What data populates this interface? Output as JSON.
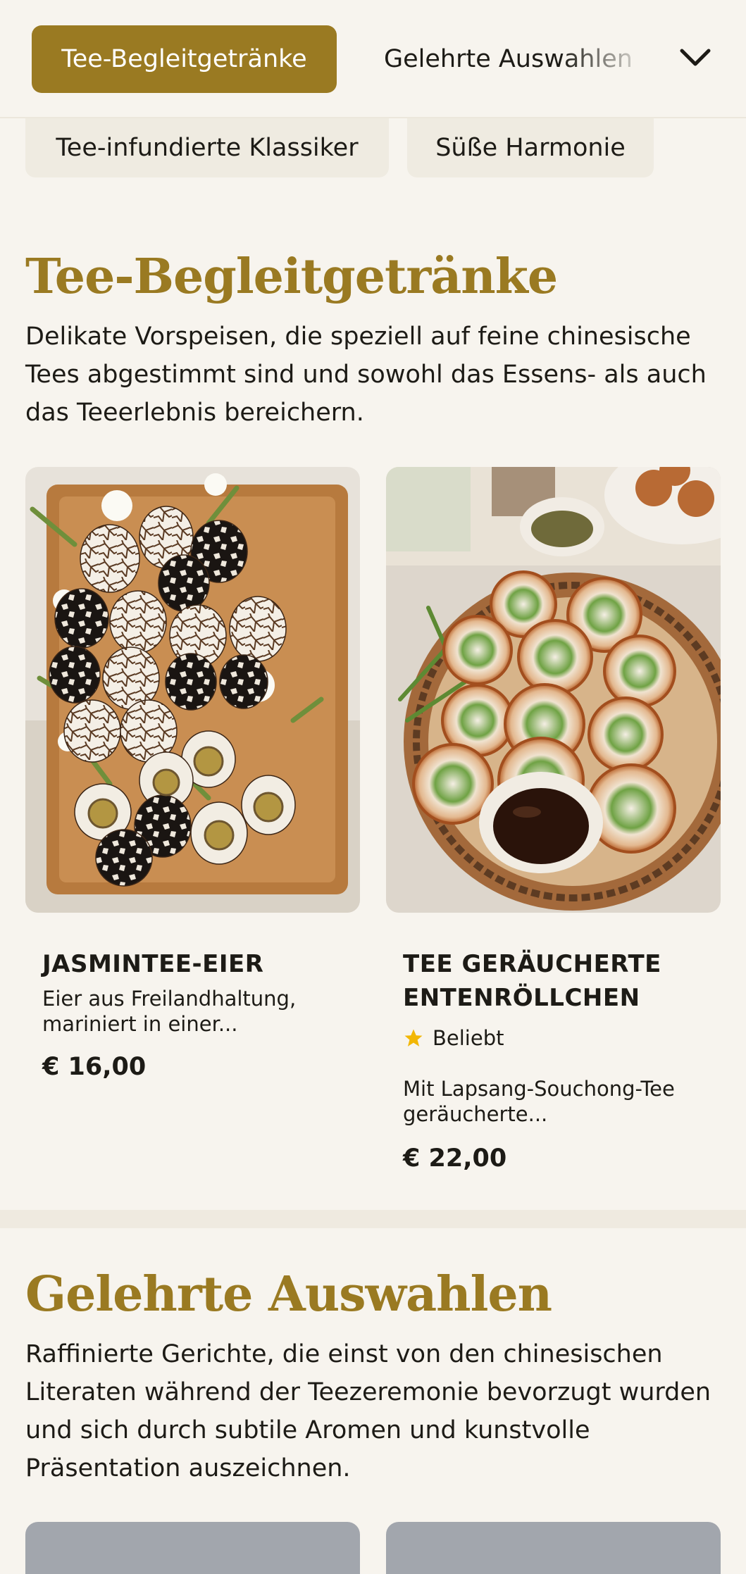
{
  "nav": {
    "active_category": "Tee-Begleitgetränke",
    "next_category": "Gelehrte Auswahlen",
    "subcategories": [
      "Tee-infundierte Klassiker",
      "Süße Harmonie"
    ]
  },
  "sections": [
    {
      "title": "Tee-Begleitgetränke",
      "description": "Delikate Vorspeisen, die speziell auf feine chinesische Tees abgestimmt sind und sowohl das Essens- als auch das Teeerlebnis bereichern.",
      "items": [
        {
          "name": "JASMINTEE-EIER",
          "description": "Eier aus Freilandhaltung, mariniert in einer...",
          "price": "€ 16,00"
        },
        {
          "name": "TEE GERÄUCHERTE ENTENRÖLLCHEN",
          "badge": "Beliebt",
          "description": "Mit Lapsang-Souchong-Tee geräucherte...",
          "price": "€ 22,00"
        }
      ]
    },
    {
      "title": "Gelehrte Auswahlen",
      "description": "Raffinierte Gerichte, die einst von den chinesischen Literaten während der Teezeremonie bevorzugt wurden und sich durch subtile Aromen und kunstvolle Präsentation auszeichnen."
    }
  ],
  "colors": {
    "accent": "#9a7a22",
    "background": "#f7f4ee",
    "pill": "#efebe1",
    "placeholder": "#a2a6ad",
    "star": "#f2b705"
  },
  "icons": {
    "dropdown": "chevron-down-icon",
    "badge": "star-icon"
  }
}
